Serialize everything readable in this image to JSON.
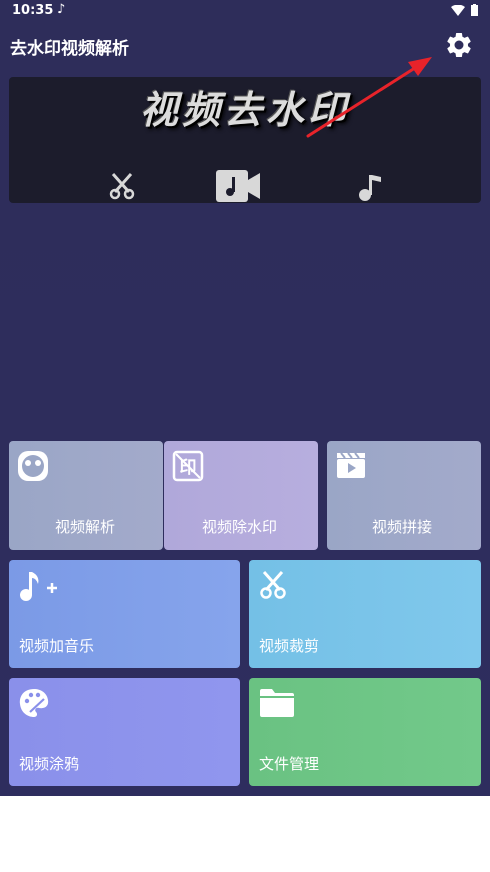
{
  "status": {
    "time": "10:35"
  },
  "appbar": {
    "title": "去水印视频解析"
  },
  "banner": {
    "title": "视频去水印"
  },
  "tiles": [
    {
      "label": "视频解析"
    },
    {
      "label": "视频除水印"
    },
    {
      "label": "视频拼接"
    },
    {
      "label": "视频加音乐"
    },
    {
      "label": "视频裁剪"
    },
    {
      "label": "视频涂鸦"
    },
    {
      "label": "文件管理"
    }
  ],
  "colors": {
    "background": "#2e2d5c",
    "tile_parse": "#9aa6c6",
    "tile_watermark": "#b3a9dc",
    "tile_splice": "#9aa6c6",
    "tile_music": "#7f9de8",
    "tile_crop": "#7ac3e8",
    "tile_doodle": "#8c92ec",
    "tile_files": "#6dc585",
    "arrow": "#e8232a"
  }
}
